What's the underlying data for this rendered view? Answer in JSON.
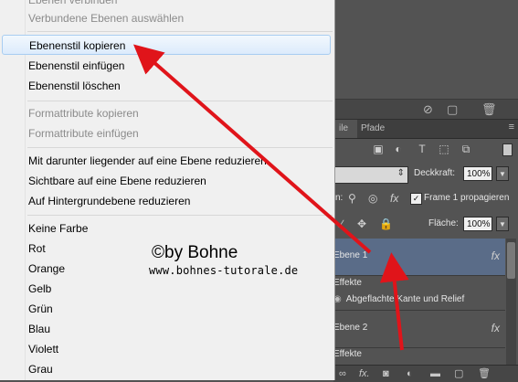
{
  "menu": {
    "items": [
      {
        "label": "Ebenen verbinden",
        "disabled": true
      },
      {
        "label": "Verbundene Ebenen auswählen",
        "disabled": true
      },
      {
        "label": "Ebenenstil kopieren",
        "disabled": false,
        "highlighted": true
      },
      {
        "label": "Ebenenstil einfügen",
        "disabled": false
      },
      {
        "label": "Ebenenstil löschen",
        "disabled": false
      },
      {
        "label": "Formattribute kopieren",
        "disabled": true
      },
      {
        "label": "Formattribute einfügen",
        "disabled": true
      },
      {
        "label": "Mit darunter liegender auf eine Ebene reduzieren",
        "disabled": false
      },
      {
        "label": "Sichtbare auf eine Ebene reduzieren",
        "disabled": false
      },
      {
        "label": "Auf Hintergrundebene reduzieren",
        "disabled": false
      },
      {
        "label": "Keine Farbe",
        "disabled": false
      },
      {
        "label": "Rot",
        "disabled": false
      },
      {
        "label": "Orange",
        "disabled": false
      },
      {
        "label": "Gelb",
        "disabled": false
      },
      {
        "label": "Grün",
        "disabled": false
      },
      {
        "label": "Blau",
        "disabled": false
      },
      {
        "label": "Violett",
        "disabled": false
      },
      {
        "label": "Grau",
        "disabled": false
      }
    ]
  },
  "watermark": {
    "line1": "©by Bohne",
    "line2": "www.bohnes-tutorale.de"
  },
  "layers_panel": {
    "tabs": [
      "ile",
      "Pfade"
    ],
    "opacity_label": "Deckkraft:",
    "opacity_value": "100%",
    "propagate_label": "Frame 1 propagieren",
    "fill_label": "Fläche:",
    "fill_value": "100%",
    "layers": [
      {
        "name": "Ebene 1",
        "selected": true,
        "effects_label": "Effekte",
        "effect": "Abgeflachte Kante und Relief"
      },
      {
        "name": "Ebene 2",
        "selected": false,
        "effects_label": "Effekte"
      }
    ],
    "fx_label": "fx"
  },
  "colors": {
    "menu_bg": "#f0f0f0",
    "highlight_border": "#a8cdf1",
    "panel_bg": "#535353",
    "selected_layer": "#5a6c88",
    "arrow": "#e0141a"
  }
}
